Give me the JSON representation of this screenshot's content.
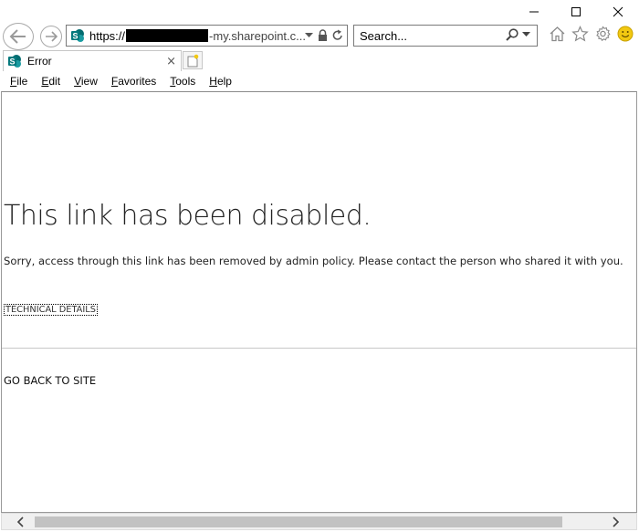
{
  "browser": {
    "address": {
      "prefix": "https://",
      "redacted": true,
      "suffix": "-my.sharepoint.c..."
    },
    "search": {
      "placeholder": "Search..."
    },
    "tab": {
      "title": "Error",
      "close": "×"
    },
    "menu": [
      {
        "acc": "F",
        "rest": "ile"
      },
      {
        "acc": "E",
        "rest": "dit"
      },
      {
        "acc": "V",
        "rest": "iew"
      },
      {
        "acc": "F",
        "rest": "avorites",
        "pre": ""
      },
      {
        "acc": "T",
        "rest": "ools"
      },
      {
        "acc": "H",
        "rest": "elp"
      }
    ],
    "icons": [
      "back-arrow-icon",
      "forward-arrow-icon",
      "sharepoint-icon",
      "dropdown-arrow-icon",
      "lock-icon",
      "refresh-icon",
      "search-icon",
      "home-icon",
      "favorites-star-icon",
      "settings-gear-icon",
      "smiley-feedback-icon"
    ]
  },
  "page": {
    "title": "This link has been disabled.",
    "message": "Sorry, access through this link has been removed by admin policy. Please contact the person who shared it with you.",
    "technical_details": "TECHNICAL DETAILS",
    "go_back": "GO BACK TO SITE"
  },
  "colors": {
    "sharepoint_teal": "#038387",
    "smiley_yellow": "#f2c811",
    "scroll_thumb": "#c2c2c2"
  }
}
